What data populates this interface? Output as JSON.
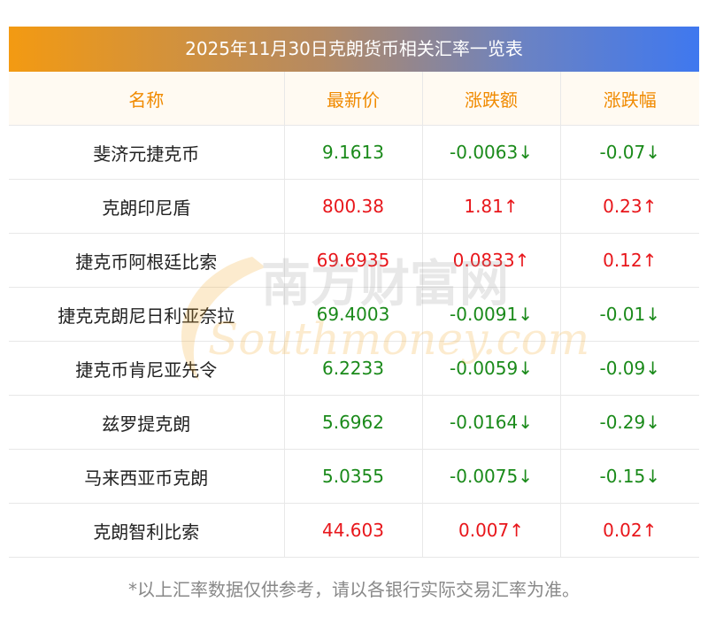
{
  "title": "2025年11月30日克朗货币相关汇率一览表",
  "headers": {
    "name": "名称",
    "price": "最新价",
    "change": "涨跌额",
    "change_pct": "涨跌幅"
  },
  "rows": [
    {
      "name": "斐济元捷克币",
      "price": "9.1613",
      "change": "-0.0063↓",
      "pct": "-0.07↓",
      "dir": "down"
    },
    {
      "name": "克朗印尼盾",
      "price": "800.38",
      "change": "1.81↑",
      "pct": "0.23↑",
      "dir": "up"
    },
    {
      "name": "捷克币阿根廷比索",
      "price": "69.6935",
      "change": "0.0833↑",
      "pct": "0.12↑",
      "dir": "up"
    },
    {
      "name": "捷克克朗尼日利亚奈拉",
      "price": "69.4003",
      "change": "-0.0091↓",
      "pct": "-0.01↓",
      "dir": "down"
    },
    {
      "name": "捷克币肯尼亚先令",
      "price": "6.2233",
      "change": "-0.0059↓",
      "pct": "-0.09↓",
      "dir": "down"
    },
    {
      "name": "兹罗提克朗",
      "price": "5.6962",
      "change": "-0.0164↓",
      "pct": "-0.29↓",
      "dir": "down"
    },
    {
      "name": "马来西亚币克朗",
      "price": "5.0355",
      "change": "-0.0075↓",
      "pct": "-0.15↓",
      "dir": "down"
    },
    {
      "name": "克朗智利比索",
      "price": "44.603",
      "change": "0.007↑",
      "pct": "0.02↑",
      "dir": "up"
    }
  ],
  "watermark": {
    "brand_cn": "南方财富网",
    "brand_en": "Southmoney.com"
  },
  "footnote": "*以上汇率数据仅供参考，请以各银行实际交易汇率为准。",
  "colors": {
    "up": "#e8161b",
    "down": "#1a8a1a",
    "header_text": "#f08a00",
    "title_gradient_start": "#f39a12",
    "title_gradient_end": "#3f78ef"
  }
}
